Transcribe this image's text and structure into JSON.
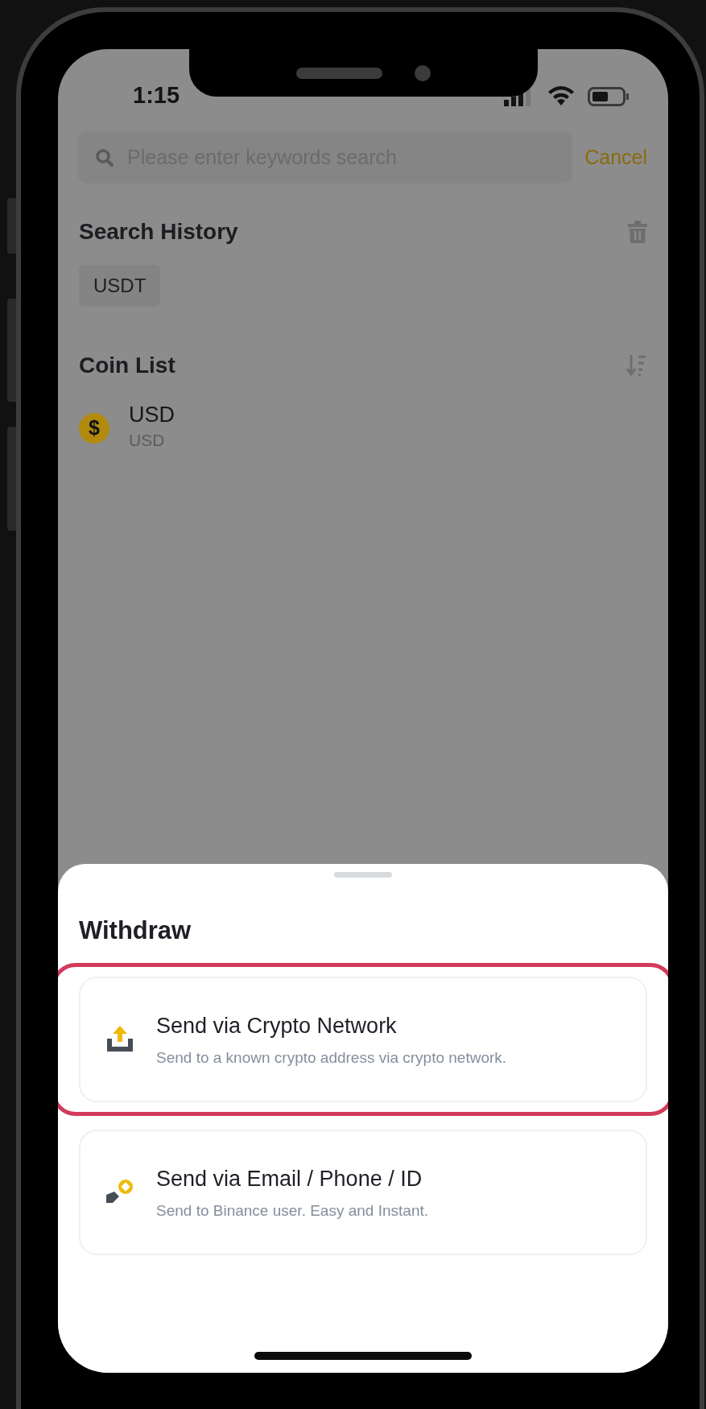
{
  "status_bar": {
    "time": "1:15"
  },
  "search": {
    "placeholder": "Please enter keywords search",
    "cancel": "Cancel"
  },
  "search_history": {
    "title": "Search History",
    "items": [
      "USDT"
    ]
  },
  "coin_list": {
    "title": "Coin List",
    "coins": [
      {
        "symbol": "$",
        "name": "USD",
        "subtitle": "USD"
      }
    ]
  },
  "sheet": {
    "title": "Withdraw",
    "options": [
      {
        "kind": "crypto",
        "title": "Send via Crypto Network",
        "subtitle": "Send to a known crypto address via crypto network.",
        "highlighted": true
      },
      {
        "kind": "internal",
        "title": "Send via Email / Phone / ID",
        "subtitle": "Send to Binance user. Easy and Instant.",
        "highlighted": false
      }
    ]
  }
}
